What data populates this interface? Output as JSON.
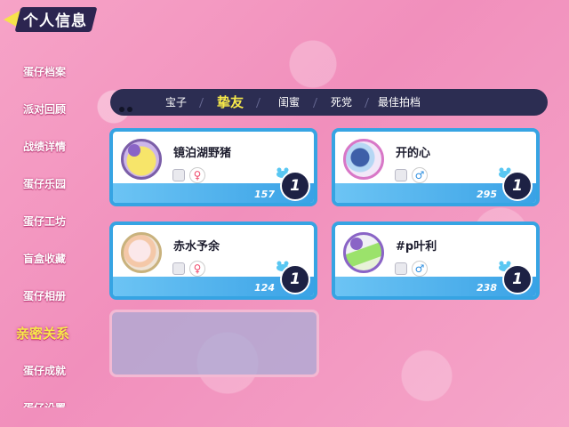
{
  "header": {
    "title": "个人信息"
  },
  "sidebar": {
    "items": [
      {
        "label": "蛋仔档案"
      },
      {
        "label": "派对回顾"
      },
      {
        "label": "战绩详情"
      },
      {
        "label": "蛋仔乐园"
      },
      {
        "label": "蛋仔工坊"
      },
      {
        "label": "盲盒收藏"
      },
      {
        "label": "蛋仔相册"
      },
      {
        "label": "亲密关系"
      },
      {
        "label": "蛋仔成就"
      },
      {
        "label": "蛋仔设置"
      }
    ],
    "active_index": 7
  },
  "tabs": [
    {
      "label": "宝子"
    },
    {
      "label": "挚友"
    },
    {
      "label": "闺蜜"
    },
    {
      "label": "死党"
    },
    {
      "label": "最佳拍档"
    }
  ],
  "active_tab": 1,
  "friends": [
    {
      "name": "镜泊湖野猪",
      "intimacy": "157",
      "rank": "1",
      "gender": "female",
      "gender_symbol": "♀"
    },
    {
      "name": "开的心",
      "intimacy": "295",
      "rank": "1",
      "gender": "male",
      "gender_symbol": "♂"
    },
    {
      "name": "赤水予余",
      "intimacy": "124",
      "rank": "1",
      "gender": "female",
      "gender_symbol": "♀"
    },
    {
      "name": "#p叶利",
      "intimacy": "238",
      "rank": "1",
      "gender": "male",
      "gender_symbol": "♂"
    }
  ],
  "colors": {
    "background": "#f18fbc",
    "accent_yellow": "#f7e94a",
    "card_border": "#36a4e3",
    "female": "#ef4b6c",
    "male": "#2f8fe0"
  }
}
